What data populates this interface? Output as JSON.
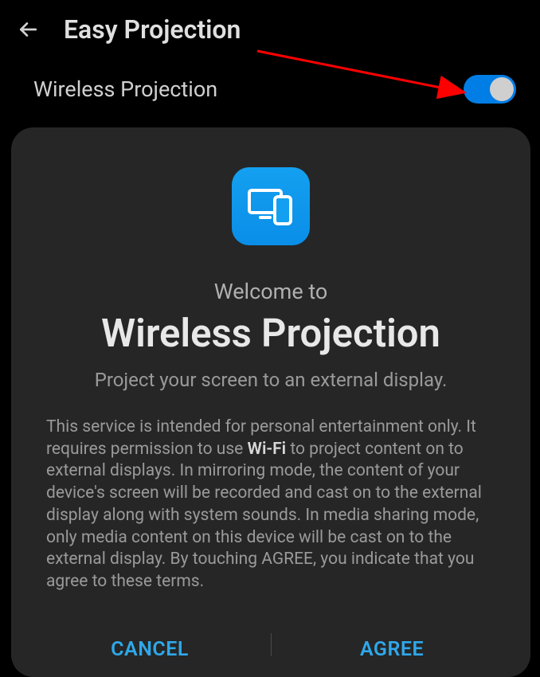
{
  "header": {
    "title": "Easy Projection"
  },
  "toggle": {
    "label": "Wireless Projection",
    "enabled": true
  },
  "dialog": {
    "welcome": "Welcome to",
    "title": "Wireless Projection",
    "subtitle": "Project your screen to an external display.",
    "desc_part1": "This service is intended for personal entertainment only. It requires permission to use ",
    "desc_bold": "Wi-Fi",
    "desc_part2": " to project content on to external displays. In mirroring mode, the content of your device's screen will be recorded and cast on to the external display along with system sounds. In media sharing mode, only media content on this device will be cast on to the external display. By touching AGREE, you indicate that you agree to these terms.",
    "cancel_label": "CANCEL",
    "agree_label": "AGREE"
  }
}
